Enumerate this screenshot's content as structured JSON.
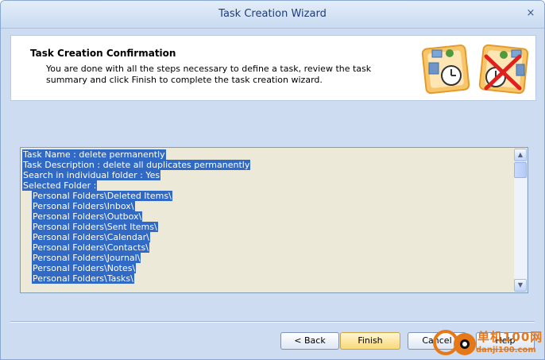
{
  "window": {
    "title": "Task Creation Wizard",
    "close_glyph": "×"
  },
  "header": {
    "title": "Task Creation Confirmation",
    "description": "You are done with all the steps necessary to define a task, review the task summary and click Finish to complete the task creation wizard."
  },
  "summary": {
    "lines": [
      {
        "text": "Task Name : delete permanently",
        "indent": false
      },
      {
        "text": "Task Description : delete all duplicates permanently",
        "indent": false
      },
      {
        "text": "Search in individual folder : Yes",
        "indent": false
      },
      {
        "text": "Selected Folder :",
        "indent": false
      },
      {
        "text": "Personal Folders\\Deleted Items\\",
        "indent": true
      },
      {
        "text": "Personal Folders\\Inbox\\",
        "indent": true
      },
      {
        "text": "Personal Folders\\Outbox\\",
        "indent": true
      },
      {
        "text": "Personal Folders\\Sent Items\\",
        "indent": true
      },
      {
        "text": "Personal Folders\\Calendar\\",
        "indent": true
      },
      {
        "text": "Personal Folders\\Contacts\\",
        "indent": true
      },
      {
        "text": "Personal Folders\\Journal\\",
        "indent": true
      },
      {
        "text": "Personal Folders\\Notes\\",
        "indent": true
      },
      {
        "text": "Personal Folders\\Tasks\\",
        "indent": true
      }
    ]
  },
  "buttons": {
    "back": "< Back",
    "finish": "Finish",
    "cancel": "Cancel",
    "help": "Help"
  },
  "watermark": {
    "text1": "单机100网",
    "text2": "danji100.com"
  },
  "colors": {
    "selection": "#316ac5",
    "window_bg": "#cddcf0",
    "finish_button": "#f9d877",
    "watermark": "#e67817"
  }
}
